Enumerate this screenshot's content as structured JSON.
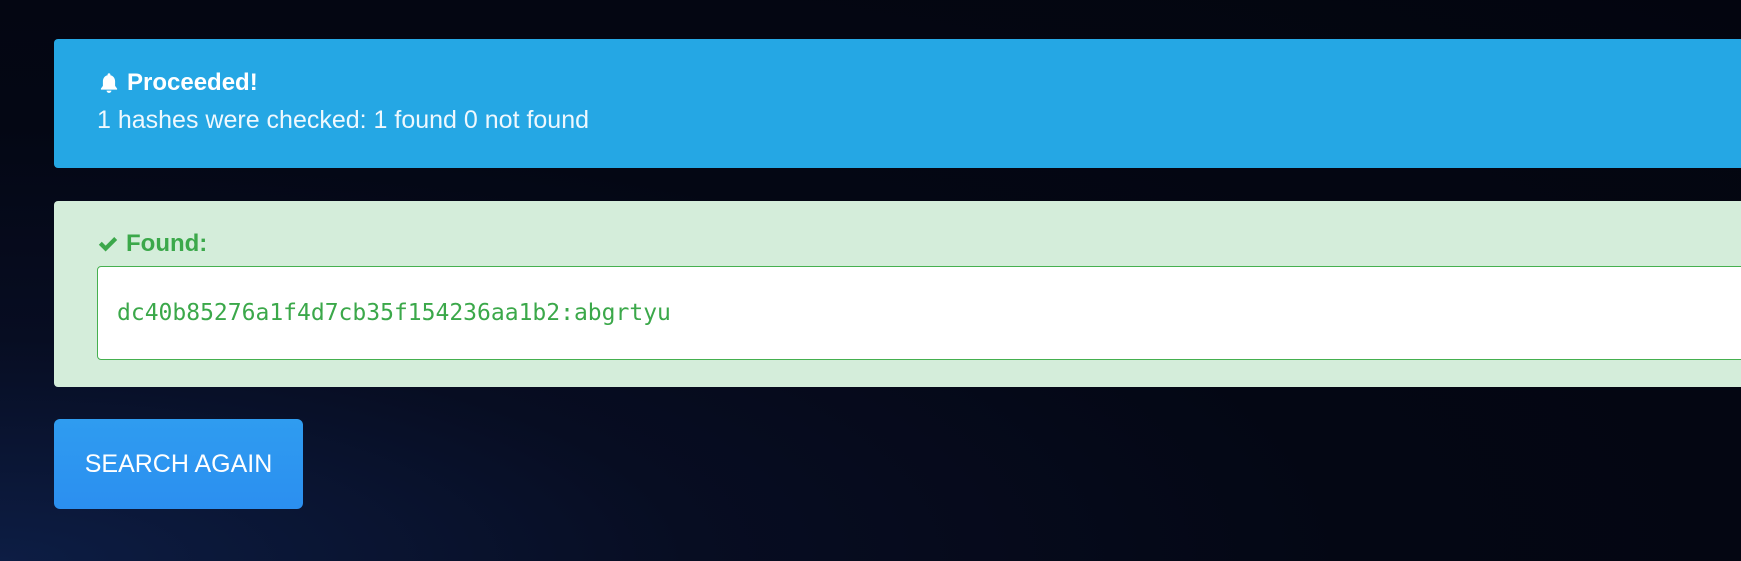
{
  "alert": {
    "icon": "bell-icon",
    "title": "Proceeded!",
    "message": "1 hashes were checked: 1 found 0 not found",
    "color": "#25a7e4"
  },
  "found": {
    "icon": "check-icon",
    "label": "Found:",
    "result": "dc40b85276a1f4d7cb35f154236aa1b2:abgrtyu",
    "color": "#3ba84a",
    "background": "#d4edda"
  },
  "actions": {
    "search_again_label": "SEARCH AGAIN"
  }
}
